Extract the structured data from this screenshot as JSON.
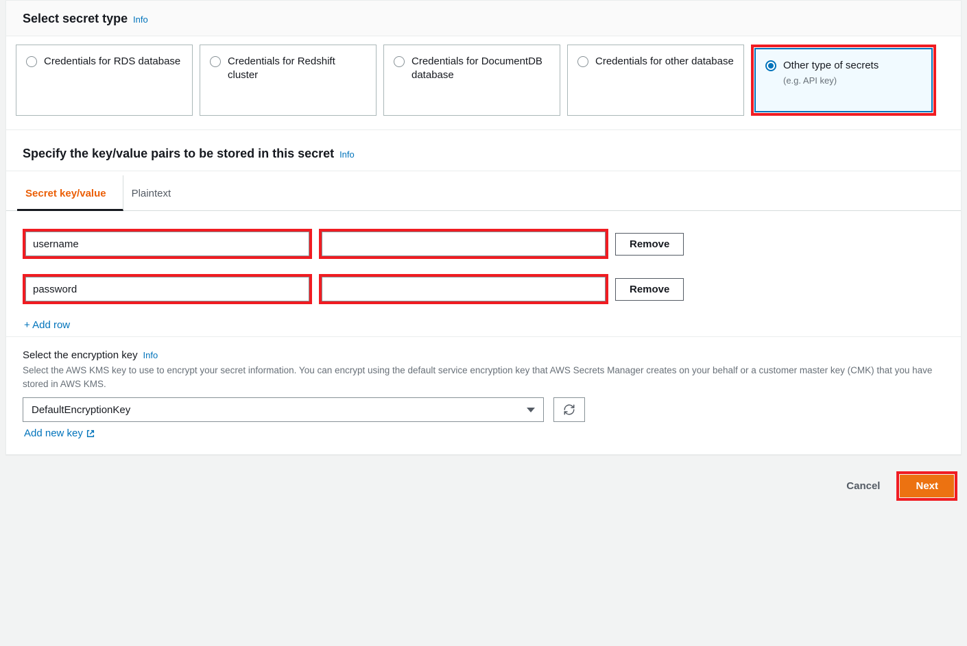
{
  "select_type": {
    "title": "Select secret type",
    "info": "Info",
    "options": [
      {
        "label": "Credentials for RDS database"
      },
      {
        "label": "Credentials for Redshift cluster"
      },
      {
        "label": "Credentials for DocumentDB database"
      },
      {
        "label": "Credentials for other database"
      },
      {
        "label": "Other type of secrets",
        "sub": "(e.g. API key)",
        "selected": true
      }
    ]
  },
  "kv": {
    "title": "Specify the key/value pairs to be stored in this secret",
    "info": "Info",
    "tabs": {
      "kv": "Secret key/value",
      "plaintext": "Plaintext"
    },
    "rows": [
      {
        "key": "username",
        "value": "",
        "remove": "Remove"
      },
      {
        "key": "password",
        "value": "",
        "remove": "Remove"
      }
    ],
    "add_row": "+ Add row"
  },
  "encryption": {
    "label": "Select the encryption key",
    "info": "Info",
    "desc": "Select the AWS KMS key to use to encrypt your secret information. You can encrypt using the default service encryption key that AWS Secrets Manager creates on your behalf or a customer master key (CMK) that you have stored in AWS KMS.",
    "selected": "DefaultEncryptionKey",
    "add_new": "Add new key"
  },
  "footer": {
    "cancel": "Cancel",
    "next": "Next"
  }
}
